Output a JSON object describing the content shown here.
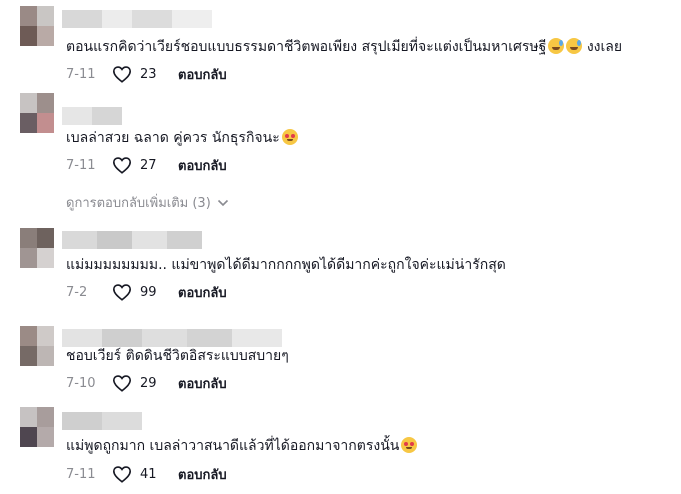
{
  "comments": [
    {
      "text": "ตอนแรกคิดว่าเวียร์ชอบแบบธรรมดาชีวิตพอเพียง สรุปเมียที่จะแต่งเป็นมหาเศรษฐี",
      "text_suffix": "งงเลย",
      "emojis": [
        "grinning-sweat-emoji",
        "grinning-sweat-emoji"
      ],
      "date": "7-11",
      "likes": "23",
      "reply_label": "ตอบกลับ"
    },
    {
      "text": "เบลล่าสวย ฉลาด คู่ควร นักธุรกิจนะ",
      "emojis": [
        "smiling-hearts-emoji"
      ],
      "date": "7-11",
      "likes": "27",
      "reply_label": "ตอบกลับ",
      "view_more": "ดูการตอบกลับเพิ่มเติม (3)"
    },
    {
      "text": "แม่มมมมมมมม.. แม่ขาพูดได้ดีมากกกกพูดได้ดีมากค่ะถูกใจค่ะแม่น่ารักสุด",
      "date": "7-2",
      "likes": "99",
      "reply_label": "ตอบกลับ"
    },
    {
      "text": "ชอบเวียร์ ติดดินชีวิตอิสระแบบสบายๆ",
      "date": "7-10",
      "likes": "29",
      "reply_label": "ตอบกลับ"
    },
    {
      "text": "แม่พูดถูกมาก เบลล่าวาสนาดีแล้วที่ได้ออกมาจากตรงนั้น",
      "emojis": [
        "smiling-hearts-emoji"
      ],
      "date": "7-11",
      "likes": "41",
      "reply_label": "ตอบกลับ"
    }
  ],
  "icons": {
    "like": "heart-outline-icon",
    "expand": "chevron-down-icon"
  },
  "colors": {
    "text": "#161823",
    "muted": "#8a8b91",
    "emoji_face": "#f7c744",
    "emoji_heart": "#e23b4a"
  }
}
